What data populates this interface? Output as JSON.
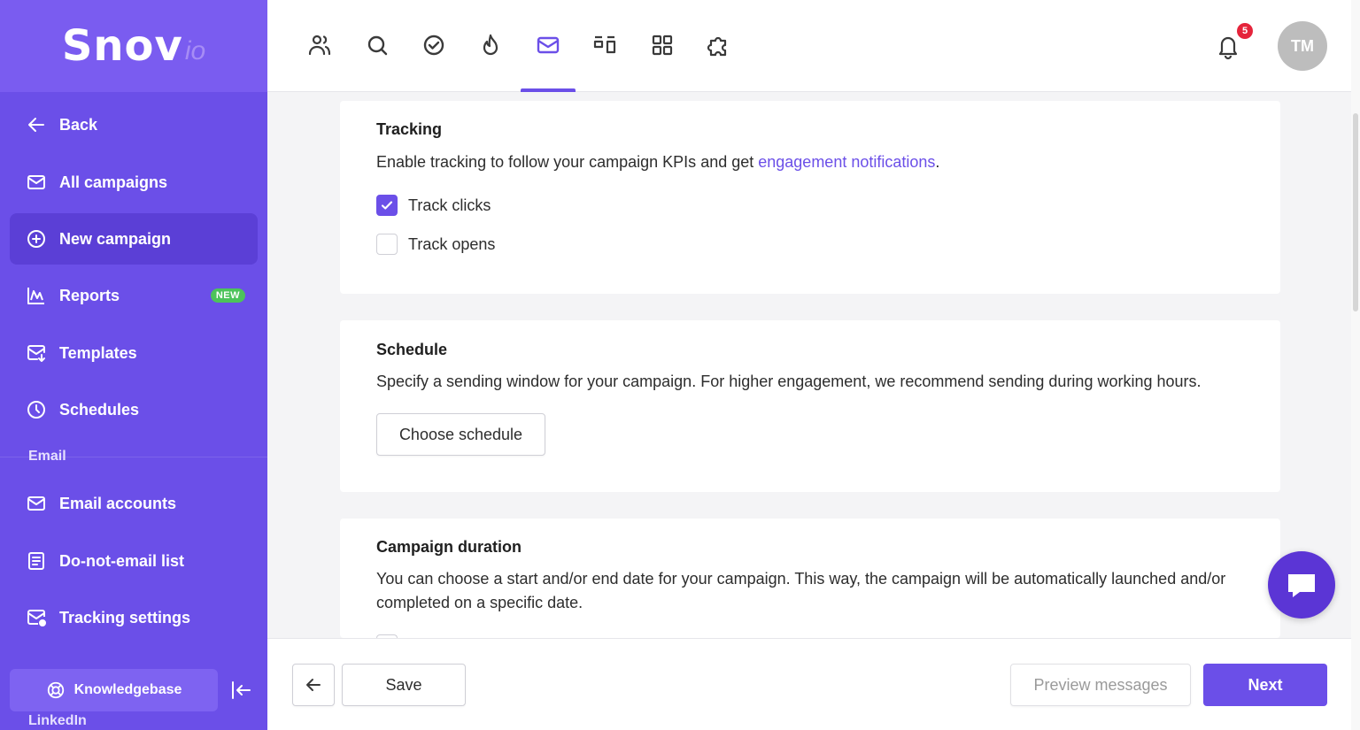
{
  "app": {
    "logo_main": "Snov",
    "logo_suffix": "io"
  },
  "sidebar": {
    "items": [
      {
        "label": "Back",
        "icon": "arrow-left-icon"
      },
      {
        "label": "All campaigns",
        "icon": "mail-icon"
      },
      {
        "label": "New campaign",
        "icon": "plus-circle-icon",
        "active": true
      },
      {
        "label": "Reports",
        "icon": "chart-icon",
        "badge": "NEW"
      },
      {
        "label": "Templates",
        "icon": "mail-template-icon"
      },
      {
        "label": "Schedules",
        "icon": "clock-icon"
      },
      {
        "label": "Email accounts",
        "icon": "mail-icon"
      },
      {
        "label": "Do-not-email list",
        "icon": "list-doc-icon"
      },
      {
        "label": "Tracking settings",
        "icon": "mail-tracking-icon"
      }
    ],
    "section_email": "Email",
    "section_linkedin": "LinkedIn",
    "knowledgebase": "Knowledgebase"
  },
  "topbar": {
    "icons": [
      "users-icon",
      "search-icon",
      "check-circle-icon",
      "flame-icon",
      "mail-icon",
      "layout-icon",
      "grid-icon",
      "puzzle-icon"
    ],
    "active_index": 4,
    "notification_count": "5",
    "avatar_initials": "TM"
  },
  "tracking": {
    "title": "Tracking",
    "description_pre": "Enable tracking to follow your campaign KPIs and get ",
    "description_link": "engagement notifications",
    "description_post": ".",
    "track_clicks_label": "Track clicks",
    "track_clicks_checked": true,
    "track_opens_label": "Track opens",
    "track_opens_checked": false
  },
  "schedule": {
    "title": "Schedule",
    "description": "Specify a sending window for your campaign. For higher engagement, we recommend sending during working hours.",
    "button_label": "Choose schedule"
  },
  "duration": {
    "title": "Campaign duration",
    "description_line1": "You can choose a start and/or end date for your campaign. This way, the campaign will be automatically launched and/or",
    "description_line2": "completed on a specific date."
  },
  "footer": {
    "save_label": "Save",
    "preview_label": "Preview messages",
    "next_label": "Next"
  },
  "colors": {
    "accent": "#6b4fe8",
    "sidebar_bg": "#6b4fe8",
    "badge_green": "#4cc35a",
    "notification_red": "#e5243b"
  }
}
